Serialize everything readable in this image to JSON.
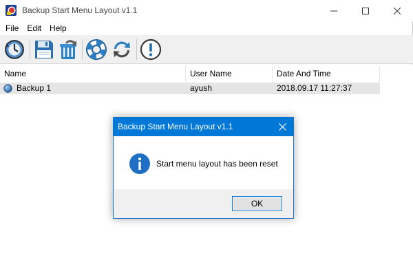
{
  "window": {
    "title": "Backup Start Menu Layout v1.1"
  },
  "menu": {
    "items": [
      "File",
      "Edit",
      "Help"
    ]
  },
  "toolbar": {
    "buttons": [
      "backup-clock-icon",
      "save-disk-icon",
      "recycle-bin-icon",
      "lifebuoy-icon",
      "refresh-icon",
      "info-exclamation-icon"
    ]
  },
  "list": {
    "columns": [
      "Name",
      "User Name",
      "Date And Time"
    ],
    "rows": [
      {
        "name": "Backup 1",
        "user": "ayush",
        "datetime": "2018.09.17 11:27:37"
      }
    ]
  },
  "dialog": {
    "title": "Backup Start Menu Layout v1.1",
    "message": "Start menu layout has been reset",
    "ok_label": "OK"
  },
  "colors": {
    "accent": "#0078d7",
    "toolbar_bg": "#f0f0f0",
    "row_selected": "#e5e5e5"
  }
}
